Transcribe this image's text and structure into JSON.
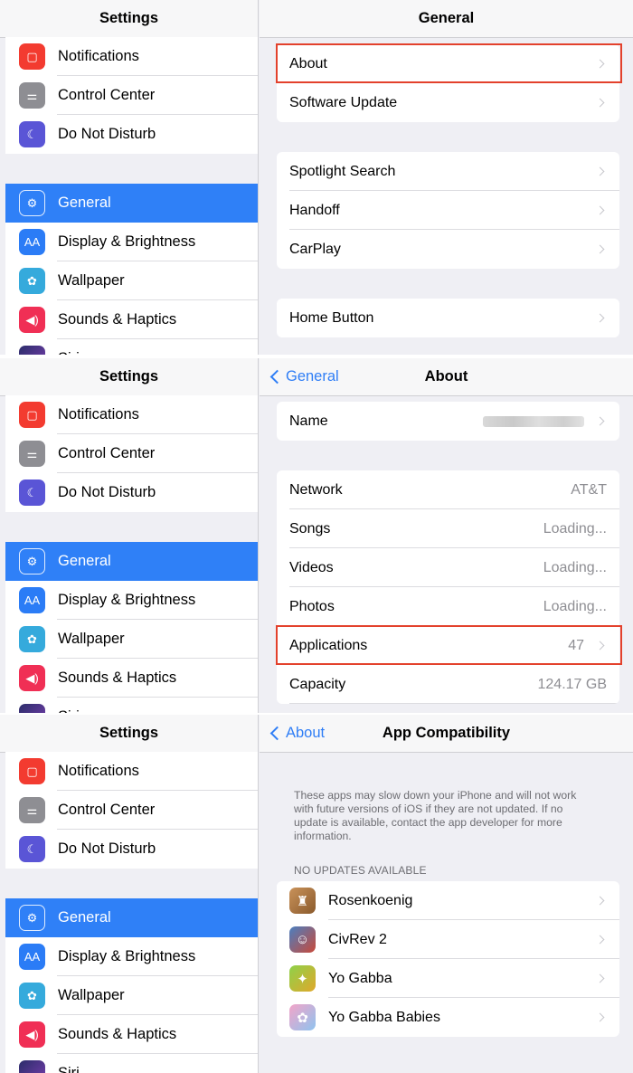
{
  "sidebar": {
    "title": "Settings",
    "items": [
      {
        "label": "Notifications",
        "icon": "notifications-icon"
      },
      {
        "label": "Control Center",
        "icon": "control-center-icon"
      },
      {
        "label": "Do Not Disturb",
        "icon": "moon-icon"
      },
      {
        "label": "General",
        "icon": "gear-icon"
      },
      {
        "label": "Display & Brightness",
        "icon": "display-brightness-icon"
      },
      {
        "label": "Wallpaper",
        "icon": "wallpaper-icon"
      },
      {
        "label": "Sounds & Haptics",
        "icon": "speaker-icon"
      },
      {
        "label": "Siri",
        "icon": "siri-icon"
      }
    ]
  },
  "general": {
    "title": "General",
    "group1": [
      "About",
      "Software Update"
    ],
    "group2": [
      "Spotlight Search",
      "Handoff",
      "CarPlay"
    ],
    "group3": [
      "Home Button"
    ]
  },
  "about": {
    "back": "General",
    "title": "About",
    "name_label": "Name",
    "rows": [
      {
        "label": "Network",
        "value": "AT&T"
      },
      {
        "label": "Songs",
        "value": "Loading..."
      },
      {
        "label": "Videos",
        "value": "Loading..."
      },
      {
        "label": "Photos",
        "value": "Loading..."
      },
      {
        "label": "Applications",
        "value": "47"
      },
      {
        "label": "Capacity",
        "value": "124.17 GB"
      }
    ]
  },
  "compat": {
    "back": "About",
    "title": "App Compatibility",
    "description": "These apps may slow down your iPhone and will not work with future versions of iOS if they are not updated. If no update is available, contact the app developer for more information.",
    "section_header": "NO UPDATES AVAILABLE",
    "apps": [
      "Rosenkoenig",
      "CivRev 2",
      "Yo Gabba",
      "Yo Gabba Babies"
    ]
  },
  "colors": {
    "accent": "#2f80f7",
    "highlight": "#e3412c"
  }
}
